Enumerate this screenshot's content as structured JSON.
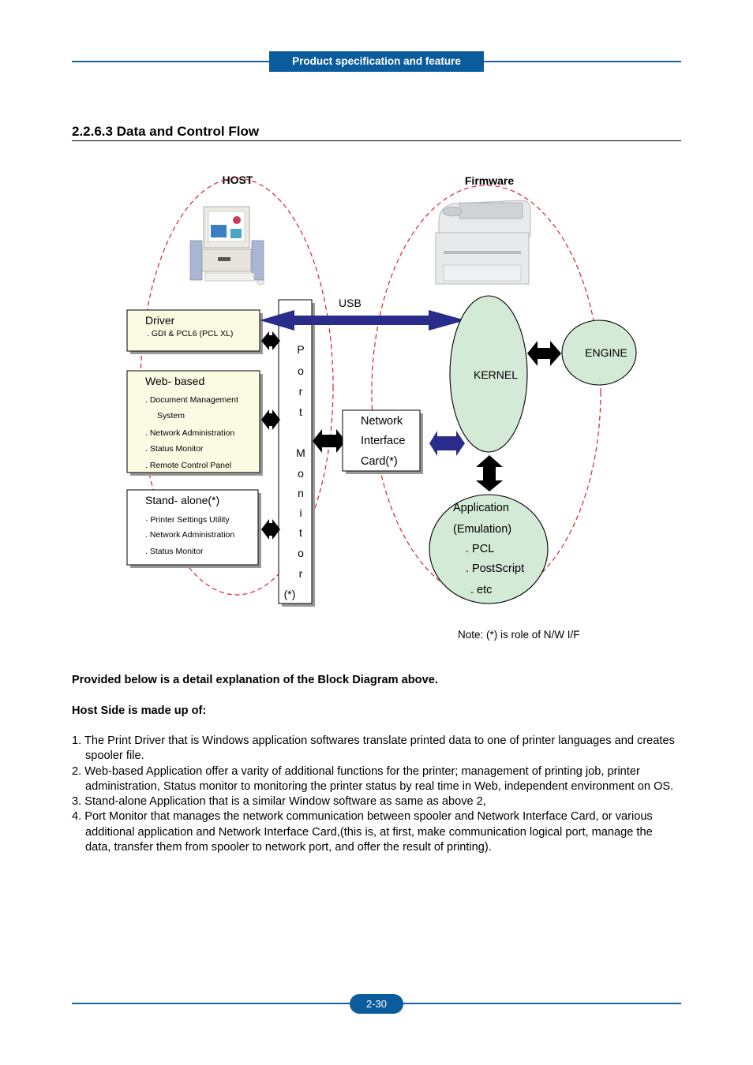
{
  "header": {
    "tab_label": "Product specification and feature"
  },
  "section": {
    "title": "2.2.6.3 Data and Control Flow"
  },
  "diagram": {
    "host_label": "HOST",
    "firmware_label": "Firmware",
    "usb_label": "USB",
    "driver": {
      "title": "Driver",
      "items": [
        ".   GDI & PCL6 (PCL XL)"
      ]
    },
    "web_based": {
      "title": "Web- based",
      "items": [
        ".  Document  Management",
        "System",
        ".  Network Administration",
        ".  Status  Monitor",
        ".  Remote  Control  Panel"
      ]
    },
    "stand_alone": {
      "title": "Stand- alone(*)",
      "items": [
        "·  Printer Settings Utility",
        ".  Network Administration",
        ".  Status  Monitor"
      ]
    },
    "port_monitor": {
      "letters": [
        "P",
        "o",
        "r",
        "t",
        "M",
        "o",
        "n",
        "i",
        "t",
        "o",
        "r"
      ],
      "suffix": "(*)"
    },
    "nic": {
      "lines": [
        "Network",
        "Interface",
        "Card(*)"
      ]
    },
    "kernel_label": "KERNEL",
    "engine_label": "ENGINE",
    "application": {
      "lines": [
        "Application",
        "(Emulation)",
        ".  PCL",
        ".  PostScript",
        ".  etc"
      ]
    },
    "note": "Note:  (*)  is  role  of  N/W  I/F",
    "colors": {
      "box_fill": "#fbfbe3",
      "bubble_fill": "#d3ead6",
      "usb_arrow": "#2a2c8c",
      "dashed": "#e0202a"
    }
  },
  "body": {
    "intro": "Provided below is a detail explanation of the Block Diagram above.",
    "subheading": "Host Side is made up of:",
    "items": [
      "1. The Print Driver that is Windows application softwares translate printed data to one of printer languages and creates spooler file.",
      "2. Web-based Application offer a varity of additional functions for the printer; management of printing job, printer administration, Status monitor to monitoring the printer status by real time in Web, independent environment on OS.",
      "3. Stand-alone Application that is a similar Window software as same as above 2,",
      "4. Port Monitor that manages the network communication between spooler and Network Interface Card, or various additional application and Network Interface Card,(this is, at first, make communication logical port, manage the data, transfer them from spooler to network port, and offer the result of printing)."
    ]
  },
  "footer": {
    "page_number": "2-30"
  }
}
